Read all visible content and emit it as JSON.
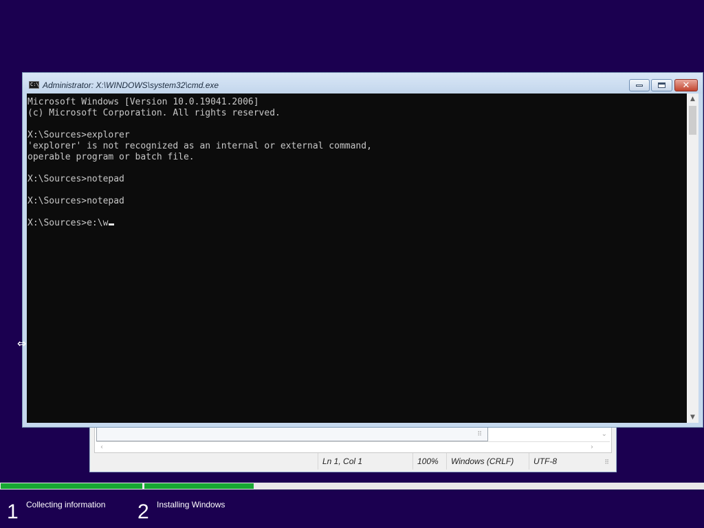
{
  "notepad": {
    "status": {
      "position": "Ln 1, Col 1",
      "zoom": "100%",
      "line_ending": "Windows (CRLF)",
      "encoding": "UTF-8"
    },
    "icons": [
      "scroll-left-icon",
      "scroll-right-icon",
      "scroll-down-icon",
      "resize-grip-icon"
    ]
  },
  "cmd": {
    "title": "Administrator: X:\\WINDOWS\\system32\\cmd.exe",
    "icon_text": "C:\\",
    "console_lines": [
      "Microsoft Windows [Version 10.0.19041.2006]",
      "(c) Microsoft Corporation. All rights reserved.",
      "",
      "X:\\Sources>explorer",
      "'explorer' is not recognized as an internal or external command,",
      "operable program or batch file.",
      "",
      "X:\\Sources>notepad",
      "",
      "X:\\Sources>notepad",
      ""
    ],
    "current_prompt": "X:\\Sources>e:\\w",
    "buttons": [
      "minimize",
      "maximize",
      "close"
    ]
  },
  "setup": {
    "steps": [
      {
        "number": "1",
        "label": "Collecting information"
      },
      {
        "number": "2",
        "label": "Installing Windows"
      }
    ],
    "step1_progress": 1.0,
    "step2_progress": 0.195,
    "colors": {
      "progress": "#17a832",
      "background": "#1b0050"
    }
  }
}
